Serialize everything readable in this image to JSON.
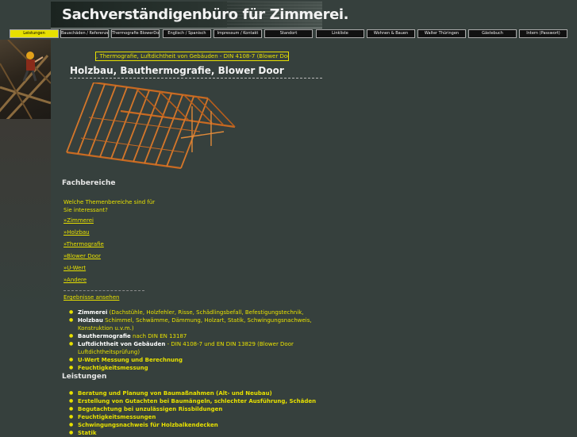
{
  "header": {
    "title": "Sachverständigenbüro für Zimmerei."
  },
  "nav": {
    "items": [
      {
        "label": "Leistungen",
        "active": true
      },
      {
        "label": "Bauschäden / Referenzen",
        "active": false
      },
      {
        "label": "Thermografie BlowerDoor",
        "active": false
      },
      {
        "label": "Englisch / Spanisch",
        "active": false
      },
      {
        "label": "Impressum / Kontakt",
        "active": false
      },
      {
        "label": "Standort",
        "active": false
      },
      {
        "label": "Linkliste",
        "active": false
      },
      {
        "label": "Wohnen & Bauen",
        "active": false
      },
      {
        "label": "Walter Thüringen",
        "active": false
      },
      {
        "label": "Gästebuch",
        "active": false
      },
      {
        "label": "Intern (Passwort)",
        "active": false
      }
    ]
  },
  "ticker": {
    "text": ", Thermografie, Luftdichtheit von Gebäuden - DIN 4108-7 (Blower Door) +++ S"
  },
  "main": {
    "title": "Holzbau, Bauthermografie, Blower Door"
  },
  "fachbereiche": {
    "heading": "Fachbereiche",
    "question": "Welche Themenbereiche sind für Sie interessant?",
    "links": [
      "»Zimmerei",
      "»Holzbau",
      "»Thermografie",
      "»Blower Door",
      "»U-Wert",
      "»Andere"
    ],
    "separator": "_______________________________",
    "results_link": "Ergebnisse ansehen"
  },
  "topics": [
    {
      "title": "Zimmerei",
      "detail": "(Dachstühle, Holzfehler, Risse, Schädlingsbefall, Befestigungstechnik,"
    },
    {
      "title": "Holzbau",
      "detail": "Schimmel, Schwämme, Dämmung, Holzart, Statik, Schwingungsnachweis, Konstruktion u.v.m.)"
    },
    {
      "title": "Bauthermografie",
      "detail": "nach DIN EN 13187"
    },
    {
      "title": "Luftdichtheit von Gebäuden",
      "detail": "- DIN 4108-7 und EN DIN 13829 (Blower Door Luftdichtheitsprüfung)"
    },
    {
      "title": "U-Wert Messung und Berechnung",
      "detail": ""
    },
    {
      "title": "Feuchtigkeitsmessung",
      "detail": ""
    }
  ],
  "leistungen": {
    "heading": "Leistungen",
    "items": [
      "Beratung und Planung von Baumaßnahmen (Alt- und Neubau)",
      "Erstellung von Gutachten bei Baumängeln, schlechter Ausführung, Schäden",
      "Begutachtung bei unzulässigen Rissbildungen",
      "Feuchtigkeitsmessungen",
      "Schwingungsnachweis für Holzbalkendecken",
      "Statik"
    ]
  },
  "colors": {
    "accent": "#e7e000",
    "background": "#36403d",
    "text": "#f2f2f2"
  },
  "icons": {
    "roof": "roof-truss-illustration",
    "worker": "carpenter-photo"
  }
}
